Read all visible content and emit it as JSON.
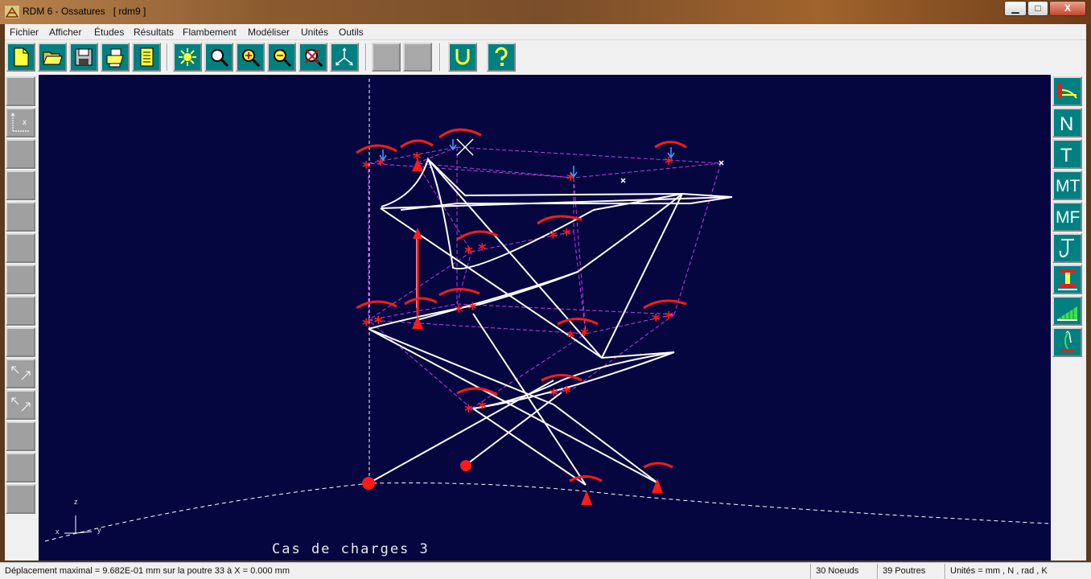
{
  "window": {
    "title": "RDM 6 - Ossatures   [ rdm9 ]",
    "minimize": "▁",
    "maximize": "□",
    "close": "X"
  },
  "menu": [
    "Fichier",
    "Afficher",
    "Études",
    "Résultats",
    "Flambement",
    "Modéliser",
    "Unités",
    "Outils"
  ],
  "toolbar": {
    "file_buttons": [
      "new-file-icon",
      "open-folder-icon",
      "save-disk-icon",
      "print-icon",
      "notes-icon"
    ],
    "view_buttons": [
      "light-icon",
      "zoom-icon",
      "zoom-in-icon",
      "zoom-out-icon",
      "zoom-cancel-icon",
      "axes-3d-icon"
    ],
    "u_label": "U",
    "help_label": "?"
  },
  "right_tools": [
    "deformed-shape-icon",
    "N",
    "T",
    "MT",
    "MF",
    "stress-icon",
    "section-icon",
    "diagram-icon",
    "buckling-icon"
  ],
  "canvas": {
    "caption": "Cas de charges 3",
    "axis_z": "z",
    "axis_x": "x",
    "axis_y": "y"
  },
  "statusbar": {
    "displacement": "Déplacement maximal = 9.682E-01 mm sur la poutre 33 à X = 0.000 mm",
    "nodes": "30 Noeuds",
    "beams": "39 Poutres",
    "units": "Unités = mm , N , rad , K"
  },
  "colors": {
    "canvas_bg": "#050540",
    "tool_teal": "#008080",
    "load_red": "#ff1a1a",
    "mesh_magenta": "#c040e0"
  }
}
